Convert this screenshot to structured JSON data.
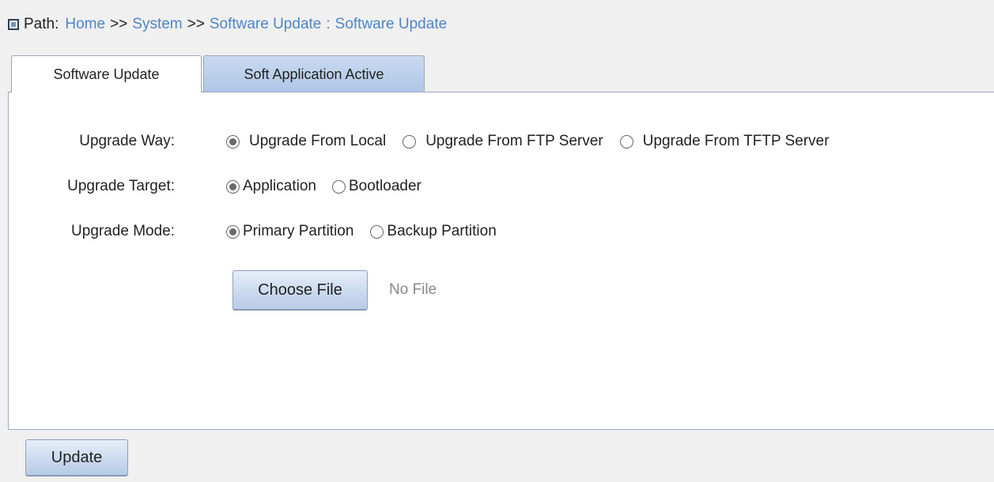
{
  "breadcrumb": {
    "label": "Path:",
    "items": [
      "Home",
      "System",
      "Software Update",
      "Software Update"
    ],
    "separator": ">>",
    "last_separator": ":"
  },
  "tabs": [
    {
      "label": "Software Update",
      "active": true
    },
    {
      "label": "Soft Application Active",
      "active": false
    }
  ],
  "form": {
    "upgrade_way": {
      "label": "Upgrade Way:",
      "options": [
        {
          "label": "Upgrade From Local",
          "checked": true
        },
        {
          "label": "Upgrade From FTP Server",
          "checked": false
        },
        {
          "label": "Upgrade From TFTP Server",
          "checked": false
        }
      ]
    },
    "upgrade_target": {
      "label": "Upgrade Target:",
      "options": [
        {
          "label": "Application",
          "checked": true
        },
        {
          "label": "Bootloader",
          "checked": false
        }
      ]
    },
    "upgrade_mode": {
      "label": "Upgrade Mode:",
      "options": [
        {
          "label": "Primary Partition",
          "checked": true
        },
        {
          "label": "Backup Partition",
          "checked": false
        }
      ]
    },
    "choose_file_label": "Choose File",
    "file_status": "No File"
  },
  "footer": {
    "update_label": "Update"
  },
  "colors": {
    "link": "#4f86c6",
    "tab_inactive": "#aec6e6",
    "button": "#c9d8ee",
    "background": "#f0f0f0"
  }
}
